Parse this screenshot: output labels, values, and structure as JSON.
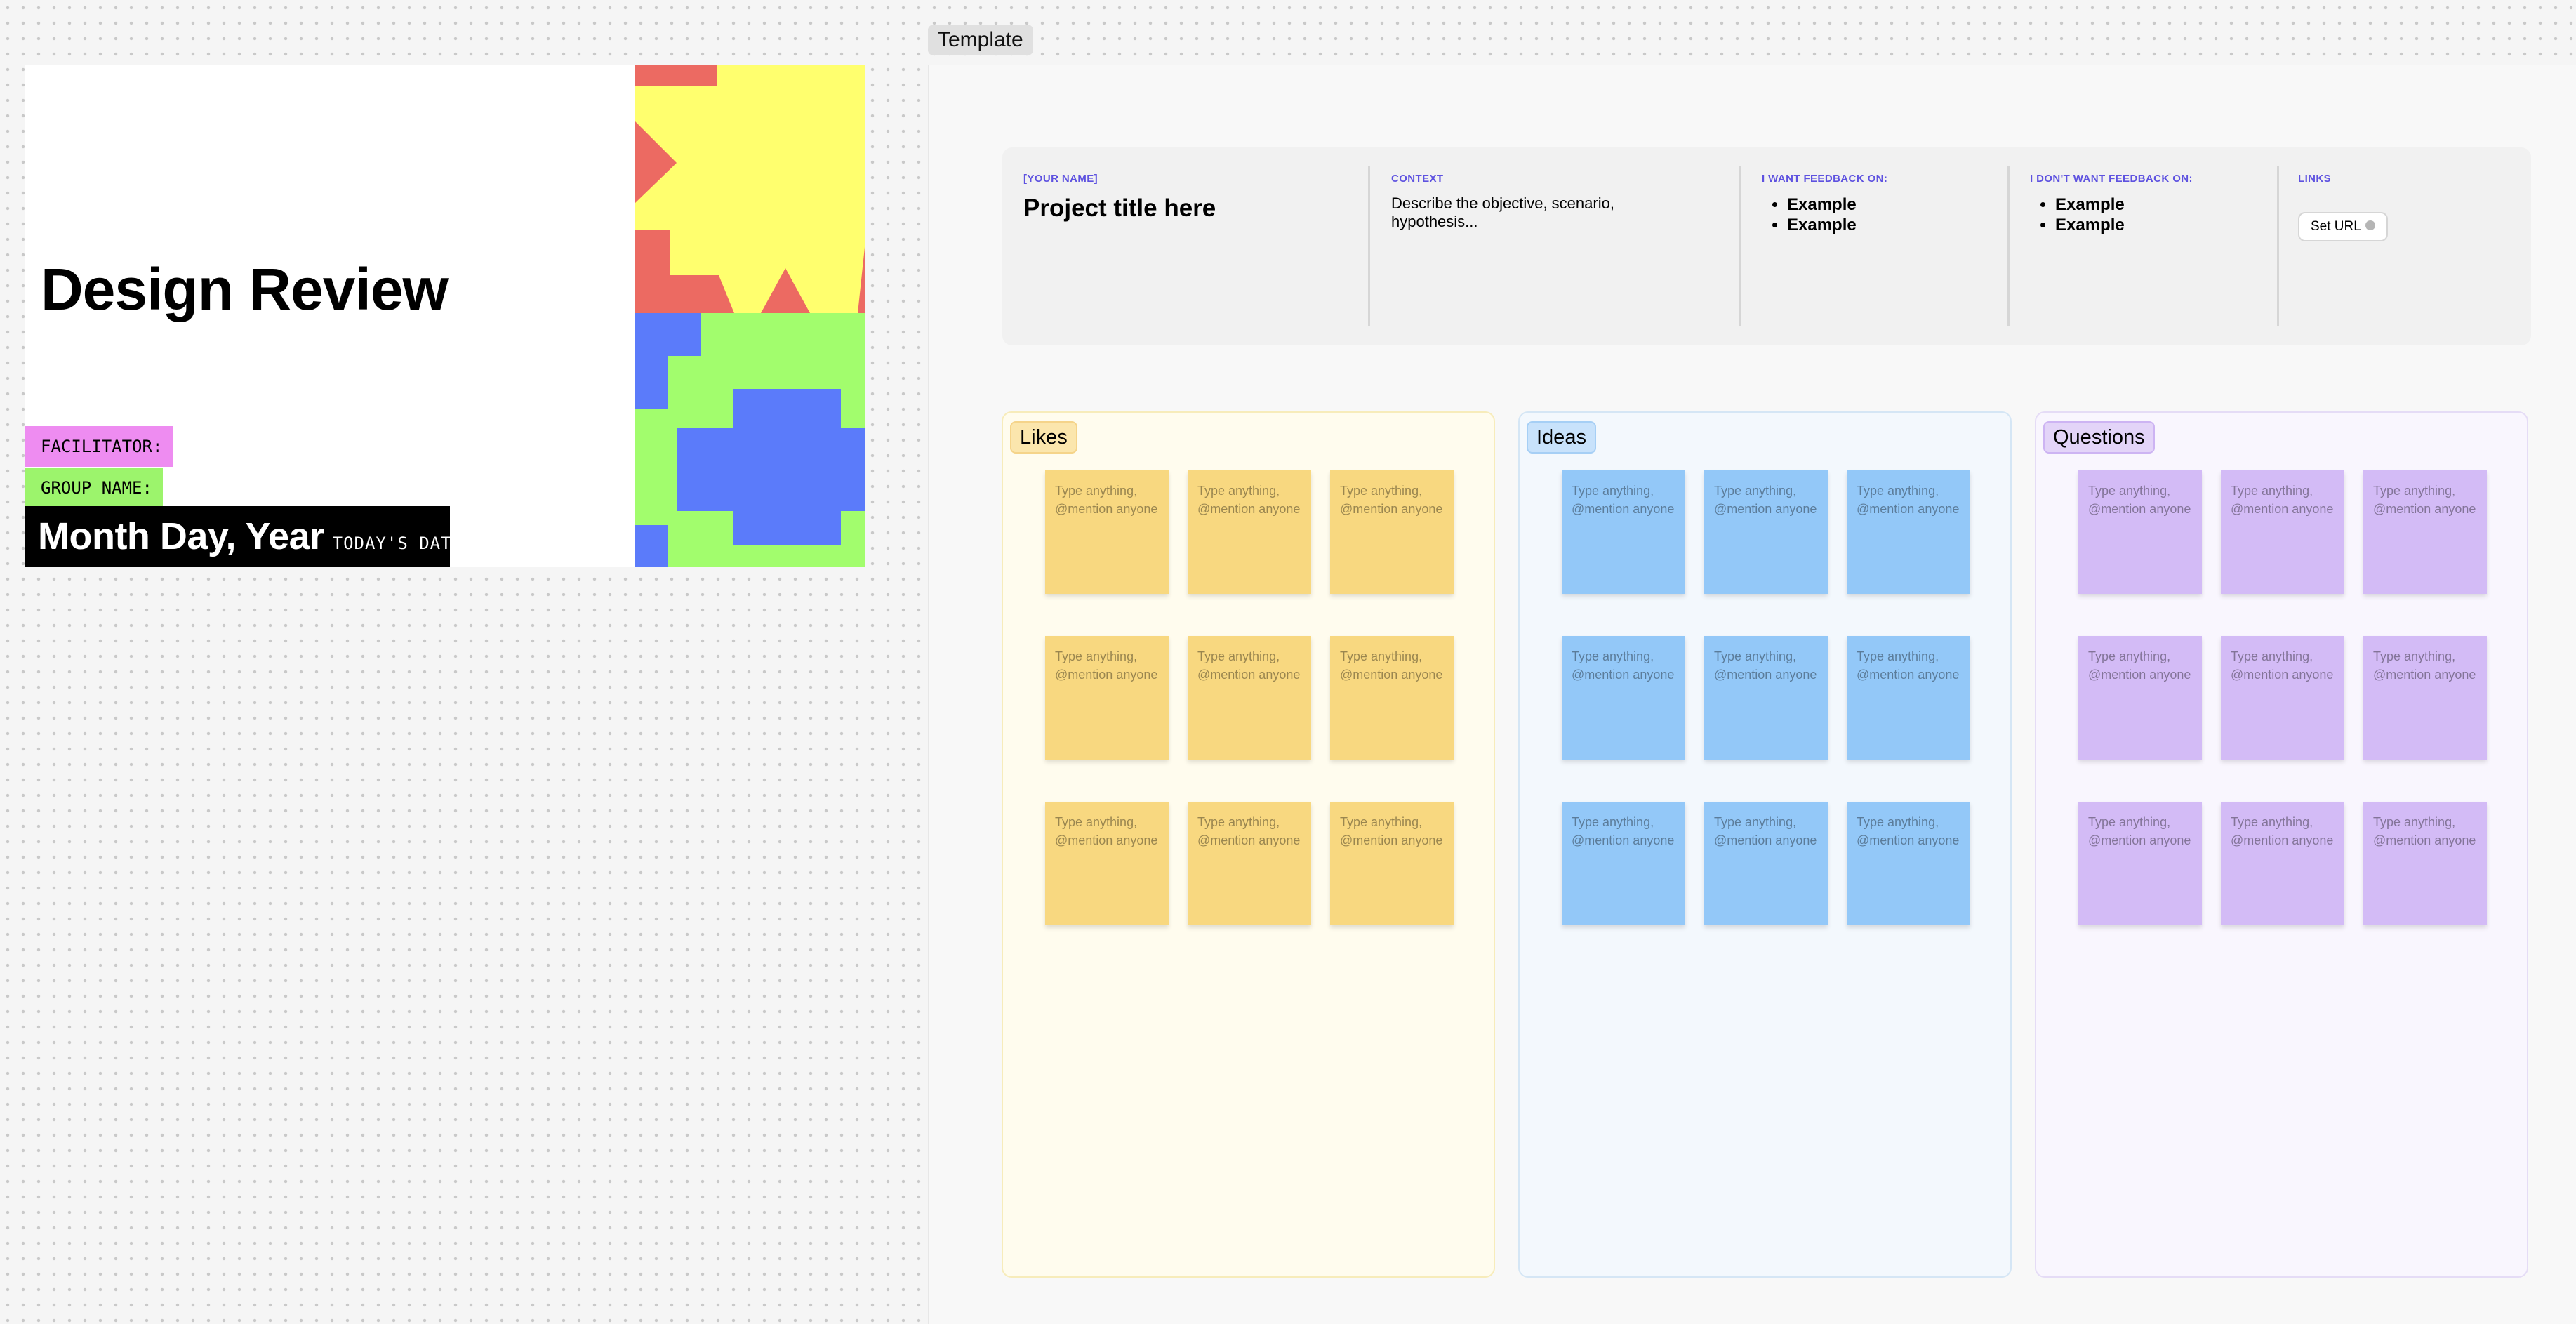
{
  "cover": {
    "title": "Design Review",
    "facilitator_label": "FACILITATOR:",
    "group_label": "GROUP NAME:",
    "date": "Month Day, Year",
    "date_caption": "TODAY'S DATE",
    "colors": {
      "red": "#ec6a62",
      "yellow": "#ffff6e",
      "green": "#a2fd6d",
      "blue": "#5b7bfa"
    }
  },
  "frame": {
    "label": "Template"
  },
  "header": {
    "name_label": "[YOUR NAME]",
    "project_title": "Project title here",
    "context_label": "CONTEXT",
    "context_text": "Describe the objective, scenario, hypothesis...",
    "want_label": "I WANT FEEDBACK ON:",
    "want_items": [
      "Example",
      "Example"
    ],
    "dont_label": "I DON'T WANT FEEDBACK ON:",
    "dont_items": [
      "Example",
      "Example"
    ],
    "links_label": "LINKS",
    "set_url_label": "Set URL"
  },
  "columns": [
    {
      "id": "likes",
      "title": "Likes",
      "color": "#f8d880",
      "notes": [
        "Type anything, @mention anyone",
        "Type anything, @mention anyone",
        "Type anything, @mention anyone",
        "Type anything, @mention anyone",
        "Type anything, @mention anyone",
        "Type anything, @mention anyone",
        "Type anything, @mention anyone",
        "Type anything, @mention anyone",
        "Type anything, @mention anyone"
      ]
    },
    {
      "id": "ideas",
      "title": "Ideas",
      "color": "#93c8f8",
      "notes": [
        "Type anything, @mention anyone",
        "Type anything, @mention anyone",
        "Type anything, @mention anyone",
        "Type anything, @mention anyone",
        "Type anything, @mention anyone",
        "Type anything, @mention anyone",
        "Type anything, @mention anyone",
        "Type anything, @mention anyone",
        "Type anything, @mention anyone"
      ]
    },
    {
      "id": "questions",
      "title": "Questions",
      "color": "#d3bbf6",
      "notes": [
        "Type anything, @mention anyone",
        "Type anything, @mention anyone",
        "Type anything, @mention anyone",
        "Type anything, @mention anyone",
        "Type anything, @mention anyone",
        "Type anything, @mention anyone",
        "Type anything, @mention anyone",
        "Type anything, @mention anyone",
        "Type anything, @mention anyone"
      ]
    }
  ]
}
